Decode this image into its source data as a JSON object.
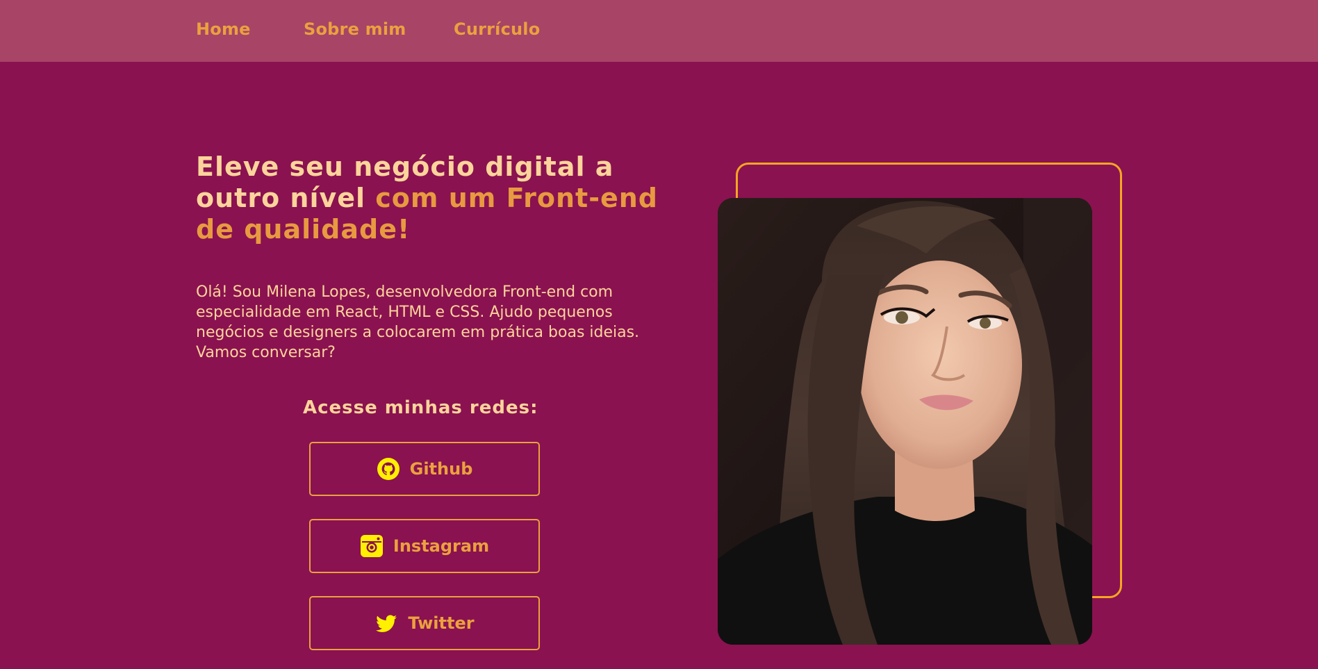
{
  "nav": {
    "items": [
      {
        "label": "Home"
      },
      {
        "label": "Sobre mim"
      },
      {
        "label": "Currículo"
      }
    ]
  },
  "hero": {
    "headline_part1": "Eleve seu negócio digital a outro nível ",
    "headline_part2": "com um Front-end de qualidade!",
    "intro": "Olá! Sou Milena Lopes, desenvolvedora Front-end com especialidade em React, HTML e CSS. Ajudo pequenos negócios e designers a colocarem em prática boas ideias. Vamos conversar?"
  },
  "social": {
    "heading": "Acesse minhas redes:",
    "links": [
      {
        "label": "Github",
        "icon": "github-icon"
      },
      {
        "label": "Instagram",
        "icon": "instagram-icon"
      },
      {
        "label": "Twitter",
        "icon": "twitter-icon"
      }
    ]
  },
  "colors": {
    "background": "#8a1250",
    "navbar": "#a84466",
    "accent": "#eba13f",
    "headline_light": "#fcd49b",
    "frame": "#f5a623",
    "icon": "#ffef00"
  }
}
